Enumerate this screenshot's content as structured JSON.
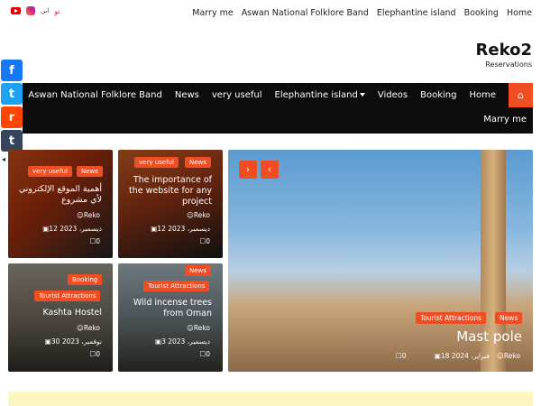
{
  "topbar": {
    "social": [
      {
        "icon": "youtube-icon"
      },
      {
        "icon": "instagram-icon",
        "label": "ابن"
      },
      {
        "icon": "telegram-icon",
        "label": "نو"
      }
    ],
    "menu": [
      "Marry me",
      "Aswan National Folklore Band",
      "Elephantine island",
      "Booking",
      "Home"
    ]
  },
  "brand": {
    "title": "Reko2",
    "subtitle": "Reservations"
  },
  "share": [
    {
      "icon": "facebook-icon",
      "glyph": "f"
    },
    {
      "icon": "twitter-icon",
      "glyph": "t"
    },
    {
      "icon": "reddit-icon",
      "glyph": "r"
    },
    {
      "icon": "tumblr-icon",
      "glyph": "t"
    }
  ],
  "nav": {
    "items": [
      "Aswan National Folklore Band",
      "News",
      "very useful",
      "Elephantine island",
      "Videos",
      "Booking",
      "Home"
    ],
    "row2": "Marry me",
    "home_icon": "home-icon",
    "accent": "#f04d23"
  },
  "cards": [
    {
      "badges": [
        "very useful",
        "News"
      ],
      "title": "أهمية الموقع الإلكتروني لأي مشروع",
      "author": "Reko",
      "date": "12 ديسمبر، 2023",
      "comments": "0"
    },
    {
      "badges": [
        "very useful",
        "News"
      ],
      "title": "The importance of the website for any project",
      "author": "Reko",
      "date": "12 ديسمبر، 2023",
      "comments": "0"
    },
    {
      "badges": [
        "Booking",
        "Tourist Attractions"
      ],
      "title": "Kashta Hostel",
      "author": "Reko",
      "date": "30 نوفمبر، 2023",
      "comments": "0"
    },
    {
      "badges": [
        "News",
        "Tourist Attractions"
      ],
      "title": "Wild incense trees from Oman",
      "author": "Reko",
      "date": "3 ديسمبر، 2023",
      "comments": "0"
    }
  ],
  "hero": {
    "badges": [
      "Tourist Attractions",
      "News"
    ],
    "title": "Mast pole",
    "author": "Reko",
    "date": "18 فبراير، 2024",
    "comments": "0",
    "prev_glyph": "‹",
    "next_glyph": "›"
  }
}
